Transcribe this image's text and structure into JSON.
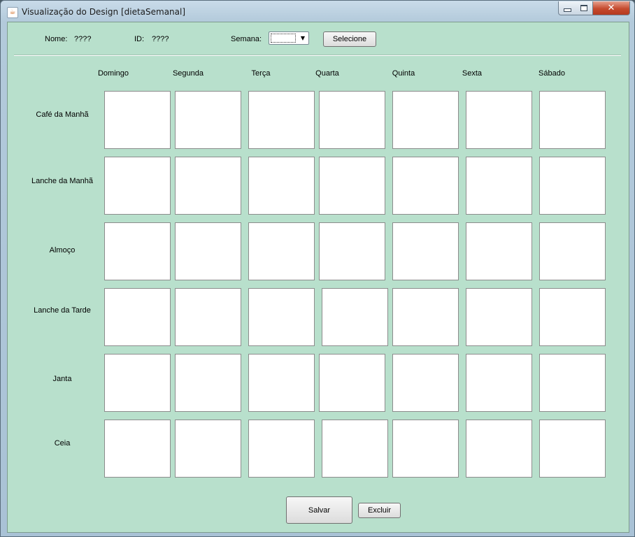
{
  "window": {
    "title": "Visualização do Design [dietaSemanal]",
    "close_glyph": "✕"
  },
  "header": {
    "nome_label": "Nome:",
    "nome_value": "????",
    "id_label": "ID:",
    "id_value": "????",
    "semana_label": "Semana:",
    "semana_selected": "",
    "selecione_label": "Selecione"
  },
  "days": [
    "Domingo",
    "Segunda",
    "Terça",
    "Quarta",
    "Quinta",
    "Sexta",
    "Sábado"
  ],
  "meals": [
    "Café da Manhã",
    "Lanche da Manhã",
    "Almoço",
    "Lanche da Tarde",
    "Janta",
    "Ceia"
  ],
  "cells": [
    [
      "",
      "",
      "",
      "",
      "",
      "",
      ""
    ],
    [
      "",
      "",
      "",
      "",
      "",
      "",
      ""
    ],
    [
      "",
      "",
      "",
      "",
      "",
      "",
      ""
    ],
    [
      "",
      "",
      "",
      "",
      "",
      "",
      ""
    ],
    [
      "",
      "",
      "",
      "",
      "",
      "",
      ""
    ],
    [
      "",
      "",
      "",
      "",
      "",
      "",
      ""
    ]
  ],
  "footer": {
    "salvar_label": "Salvar",
    "excluir_label": "Excluir"
  },
  "icons": {
    "app": "java-cup-icon",
    "select_arrow": "dropdown-arrow-icon"
  },
  "colors": {
    "panel_background": "#b8e0cc",
    "cell_background": "#ffffff",
    "close_button": "#c54a2e"
  }
}
